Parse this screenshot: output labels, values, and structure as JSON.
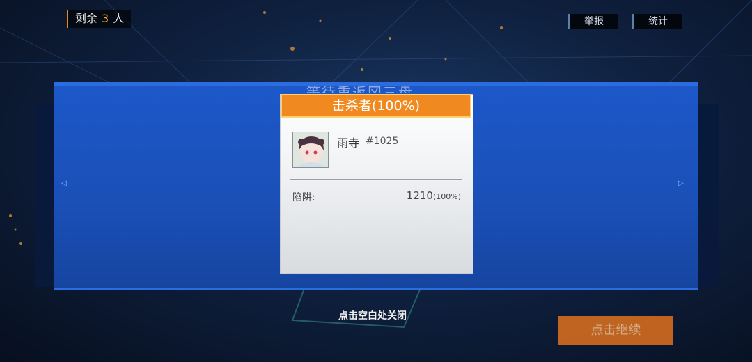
{
  "hud": {
    "remaining_label": "剩余",
    "remaining_count": "3",
    "remaining_unit": "人",
    "report_label": "举报",
    "stats_label": "统计"
  },
  "panel": {
    "title": "等待重返冈三盘"
  },
  "killer_card": {
    "header": "击杀者(100%)",
    "player_name": "雨寺",
    "player_id": "#1025",
    "trap_label": "陷阱:",
    "trap_value": "1210",
    "trap_percent": "(100%)"
  },
  "footer": {
    "close_hint": "点击空白处关闭",
    "continue_label": "点击继续"
  },
  "colors": {
    "accent_orange": "#f08a20",
    "panel_blue": "#1d58c9",
    "background_dark": "#0f2140"
  },
  "icons": {
    "left_arrow": "left-arrow-icon",
    "right_arrow": "right-arrow-icon"
  }
}
